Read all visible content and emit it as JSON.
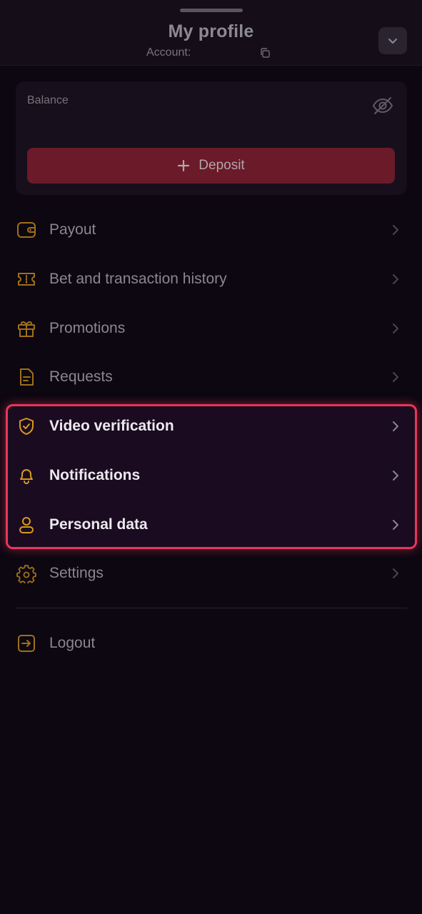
{
  "header": {
    "title": "My profile",
    "account_label": "Account:"
  },
  "balance": {
    "label": "Balance",
    "deposit_label": "Deposit"
  },
  "menu": {
    "payout": "Payout",
    "history": "Bet and transaction history",
    "promotions": "Promotions",
    "requests": "Requests",
    "video_verification": "Video verification",
    "notifications": "Notifications",
    "personal_data": "Personal data",
    "settings": "Settings",
    "logout": "Logout"
  },
  "colors": {
    "accent_icon": "#d79a1e",
    "deposit_button": "#6a1a29",
    "highlight_border": "#e5375a",
    "background": "#0c0711"
  },
  "icons": {
    "payout": "wallet-icon",
    "history": "ticket-icon",
    "promotions": "gift-icon",
    "requests": "document-icon",
    "video_verification": "shield-check-icon",
    "notifications": "bell-icon",
    "personal_data": "user-icon",
    "settings": "gear-icon",
    "logout": "logout-icon"
  }
}
